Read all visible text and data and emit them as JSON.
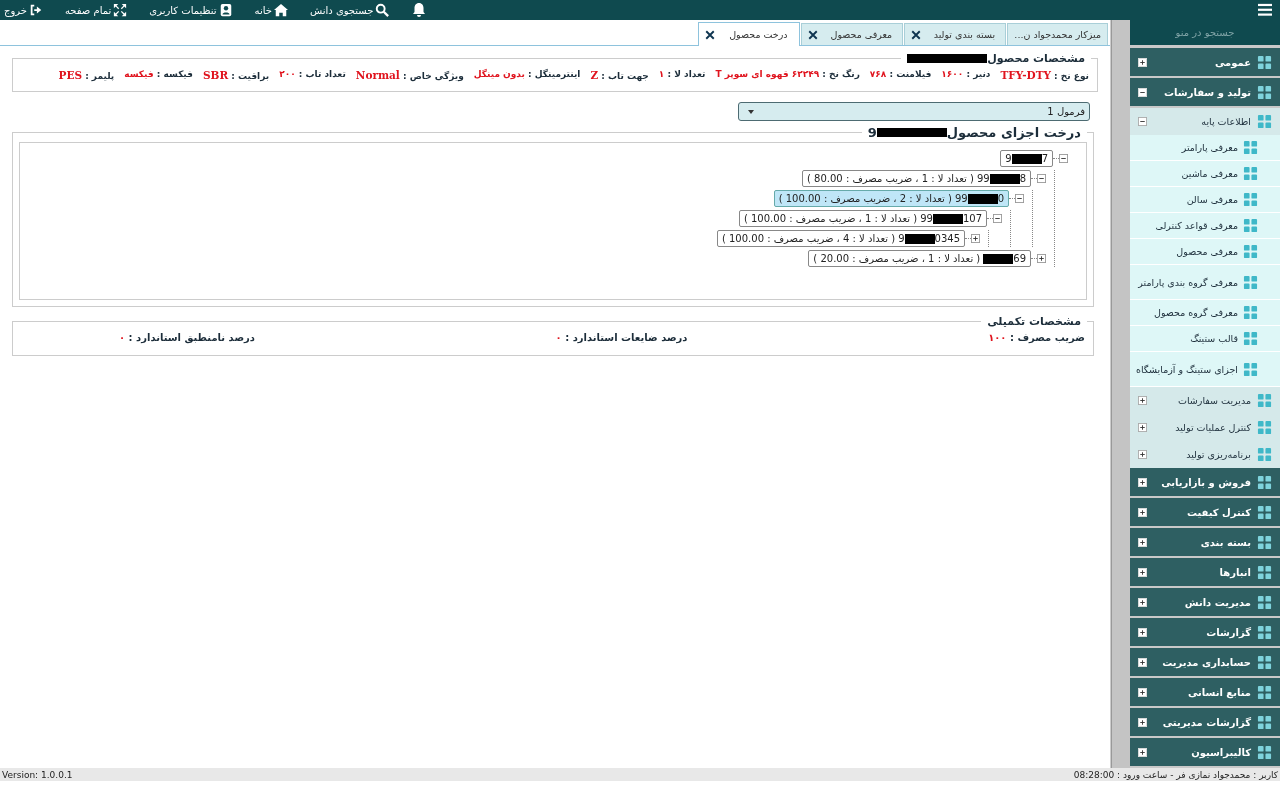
{
  "topbar": {
    "items": [
      {
        "kind": "bell"
      },
      {
        "kind": "search",
        "label": "جستجوی دانش"
      },
      {
        "kind": "home",
        "label": "خانه"
      },
      {
        "kind": "user",
        "label": "تنظیمات کاربری"
      },
      {
        "kind": "fullscreen",
        "label": "تمام صفحه"
      },
      {
        "kind": "exit",
        "label": "خروج"
      }
    ]
  },
  "tabs": [
    {
      "label": "میزکار محمدجواد ن...",
      "closable": false,
      "selected": false
    },
    {
      "label": "بسته بندی تولید",
      "closable": true,
      "selected": false
    },
    {
      "label": "معرفی محصول",
      "closable": true,
      "selected": false
    },
    {
      "label": "درخت محصول",
      "closable": true,
      "selected": true
    }
  ],
  "product_specs": {
    "title": "مشخصات محصول",
    "fields": [
      {
        "label": "نوع نخ :",
        "value": "TFY-DTY",
        "kind": "latin"
      },
      {
        "label": "دنیر :",
        "value": "۱۶۰۰",
        "kind": "digits"
      },
      {
        "label": "فیلامنت :",
        "value": "۷۶۸",
        "kind": "digits"
      },
      {
        "label": "رنگ نخ :",
        "value": "۶۲۲۴۹ قهوه ای سوپر T",
        "kind": "digits"
      },
      {
        "label": "تعداد لا :",
        "value": "۱",
        "kind": "digits"
      },
      {
        "label": "جهت تاب :",
        "value": "Z",
        "kind": "latin"
      },
      {
        "label": "اینترمینگل :",
        "value": "بدون مینگل",
        "kind": "digits"
      },
      {
        "label": "ویژگی خاص :",
        "value": "Normal",
        "kind": "latin"
      },
      {
        "label": "تعداد تاب :",
        "value": "۲۰۰",
        "kind": "digits"
      },
      {
        "label": "براقیت :",
        "value": "SBR",
        "kind": "latin"
      },
      {
        "label": "فیکسه :",
        "value": "فیکسه",
        "kind": "digits"
      },
      {
        "label": "پلیمر :",
        "value": "PES",
        "kind": "latin"
      }
    ]
  },
  "formula_dropdown": {
    "value": "فرمول 1"
  },
  "tree": {
    "title": "درخت اجزای محصول",
    "title_tail": "9",
    "nodes": [
      {
        "id_head": "9",
        "id_tail": "7",
        "expanded": true,
        "selected": false,
        "children": [
          {
            "id_head": "99",
            "id_tail": "8",
            "detail": "( تعداد لا : 1 ، ضریب مصرف : 80.00 )",
            "expanded": true,
            "selected": false,
            "children": [
              {
                "id_head": "99",
                "id_tail": "0",
                "detail": "( تعداد لا : 2 ، ضریب مصرف : 100.00 )",
                "expanded": true,
                "selected": true,
                "children": [
                  {
                    "id_head": "99",
                    "id_tail": "107",
                    "detail": "( تعداد لا : 1 ، ضریب مصرف : 100.00 )",
                    "expanded": true,
                    "selected": false,
                    "children": [
                      {
                        "id_head": "9",
                        "id_tail": "0345",
                        "detail": "( تعداد لا : 4 ، ضریب مصرف : 100.00 )",
                        "expanded": false,
                        "selected": false
                      }
                    ]
                  }
                ]
              }
            ]
          },
          {
            "id_tail": "69",
            "detail": "( تعداد لا : 1 ، ضریب مصرف : 20.00 )",
            "expanded": false,
            "selected": false
          }
        ]
      }
    ]
  },
  "extra_specs": {
    "title": "مشخصات تکمیلی",
    "fields": [
      {
        "label": "ضریب مصرف :",
        "value": "۱۰۰"
      },
      {
        "label": "درصد ضایعات استاندارد :",
        "value": "۰"
      },
      {
        "label": "درصد نامنطبق استاندارد :",
        "value": "۰"
      }
    ]
  },
  "sidebar": {
    "search_placeholder": "جستجو در منو",
    "items": [
      {
        "label": "عمومی",
        "kind": "group",
        "expanded": false
      },
      {
        "label": "تولید و سفارشات",
        "kind": "group",
        "expanded": true,
        "children": [
          {
            "label": "اطلاعات پایه",
            "kind": "section",
            "expanded": true,
            "children": [
              {
                "label": "معرفی پارامتر",
                "kind": "link"
              },
              {
                "label": "معرفی ماشین",
                "kind": "link"
              },
              {
                "label": "معرفی سالن",
                "kind": "link"
              },
              {
                "label": "معرفی قواعد کنترلی",
                "kind": "link"
              },
              {
                "label": "معرفی محصول",
                "kind": "link"
              },
              {
                "label": "معرفی گروه بندی پارامتر",
                "kind": "link"
              },
              {
                "label": "معرفی گروه محصول",
                "kind": "link"
              },
              {
                "label": "قالب ستینگ",
                "kind": "link"
              },
              {
                "label": "اجزای ستینگ و آزمایشگاه",
                "kind": "link"
              }
            ]
          },
          {
            "label": "مدیریت سفارشات",
            "kind": "section",
            "expanded": false
          },
          {
            "label": "کنترل عملیات تولید",
            "kind": "section",
            "expanded": false
          },
          {
            "label": "برنامه‌ریزی تولید",
            "kind": "section",
            "expanded": false
          }
        ]
      },
      {
        "label": "فروش و بازاریابی",
        "kind": "group",
        "expanded": false
      },
      {
        "label": "کنترل کیفیت",
        "kind": "group",
        "expanded": false
      },
      {
        "label": "بسته بندی",
        "kind": "group",
        "expanded": false
      },
      {
        "label": "انبارها",
        "kind": "group",
        "expanded": false
      },
      {
        "label": "مدیریت دانش",
        "kind": "group",
        "expanded": false
      },
      {
        "label": "گزارشات",
        "kind": "group",
        "expanded": false
      },
      {
        "label": "حسابداری مدیریت",
        "kind": "group",
        "expanded": false
      },
      {
        "label": "منابع انسانی",
        "kind": "group",
        "expanded": false
      },
      {
        "label": "گزارشات مدیریتی",
        "kind": "group",
        "expanded": false
      },
      {
        "label": "کالیبراسیون",
        "kind": "group",
        "expanded": false
      }
    ]
  },
  "status_bar": {
    "version": "Version: 1.0.0.1",
    "user": "کاربر : محمدجواد نمازی فر - ساعت ورود : 08:28:00"
  }
}
